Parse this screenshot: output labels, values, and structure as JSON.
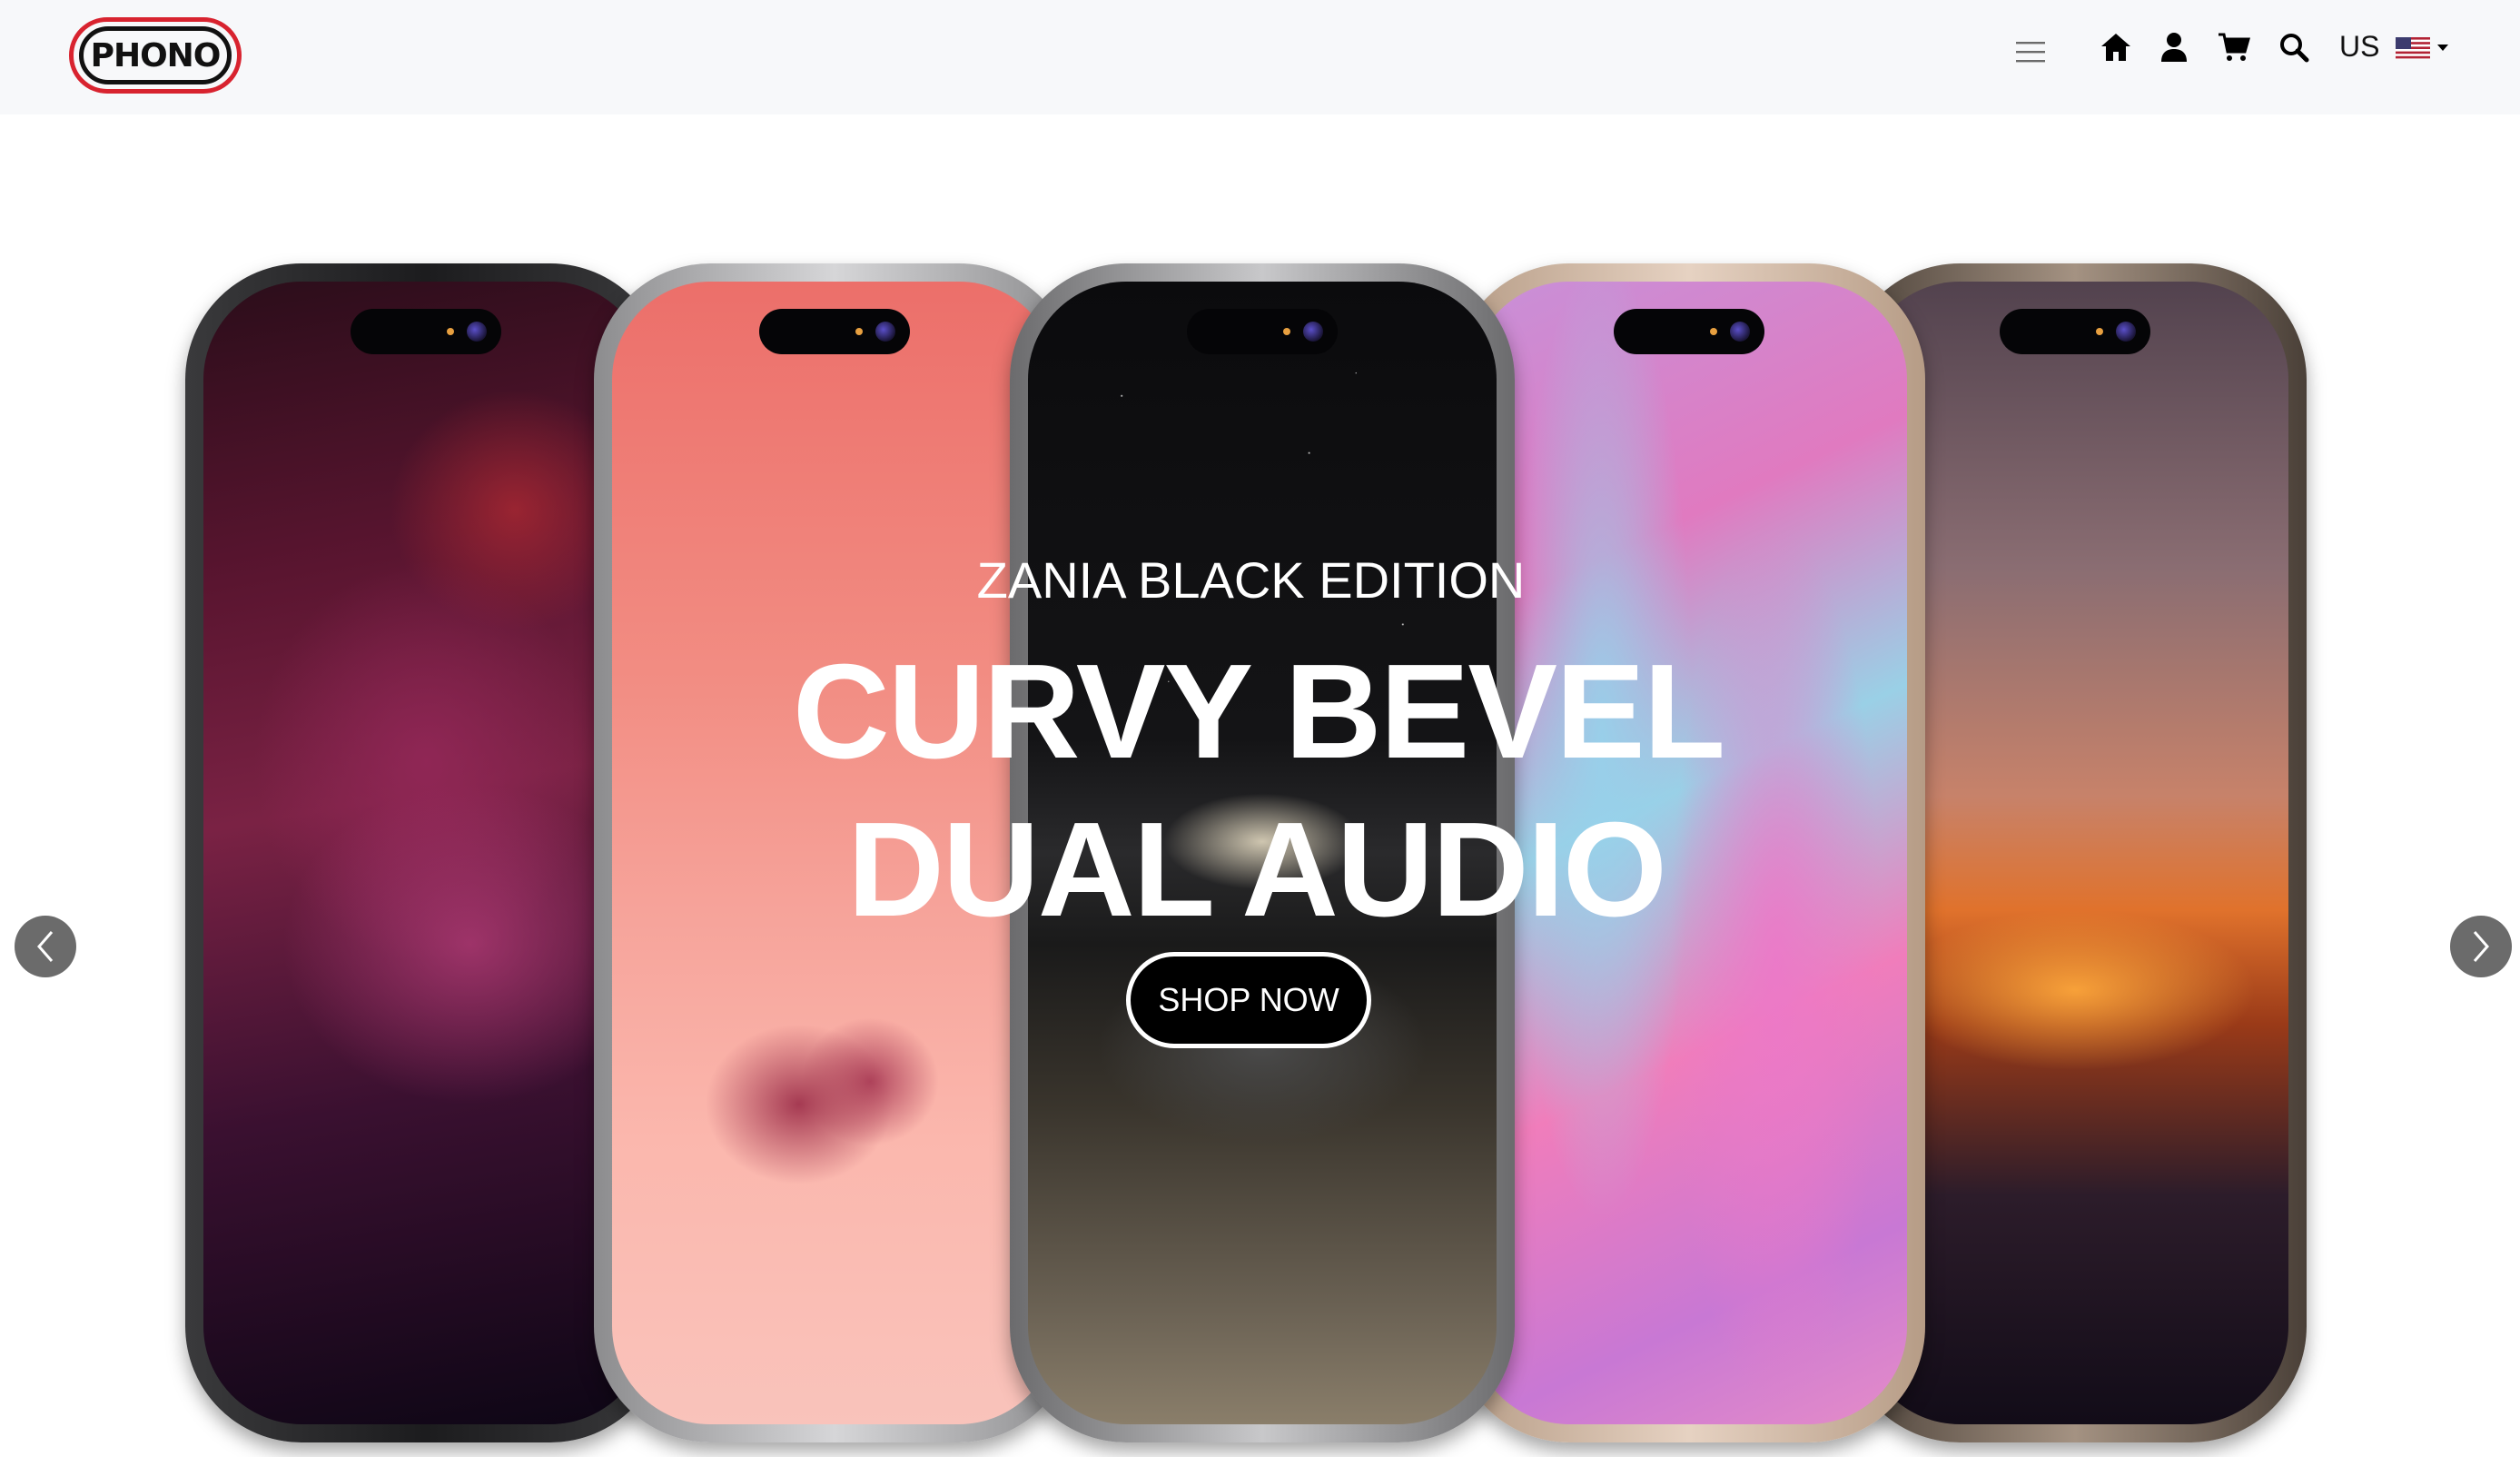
{
  "header": {
    "logo_text": "PHONO",
    "region": "US",
    "icons": [
      "menu-icon",
      "home-icon",
      "user-icon",
      "cart-icon",
      "search-icon",
      "us-flag-icon"
    ]
  },
  "hero": {
    "eyebrow": "ZANIA BLACK EDITION",
    "headline_line1": "CURVY BEVEL",
    "headline_line2": "DUAL AUDIO",
    "cta_label": "SHOP NOW",
    "slides": [
      "canyon-wallpaper-phone",
      "pink-tree-wallpaper-phone",
      "mountain-lake-wallpaper-phone",
      "fluid-art-wallpaper-phone",
      "golden-gate-sunset-wallpaper-phone"
    ]
  },
  "colors": {
    "logo_red": "#d8232f",
    "header_bg": "#f7f8fa",
    "cta_bg": "#000000",
    "arrow_bg": "#6b6b6b"
  }
}
